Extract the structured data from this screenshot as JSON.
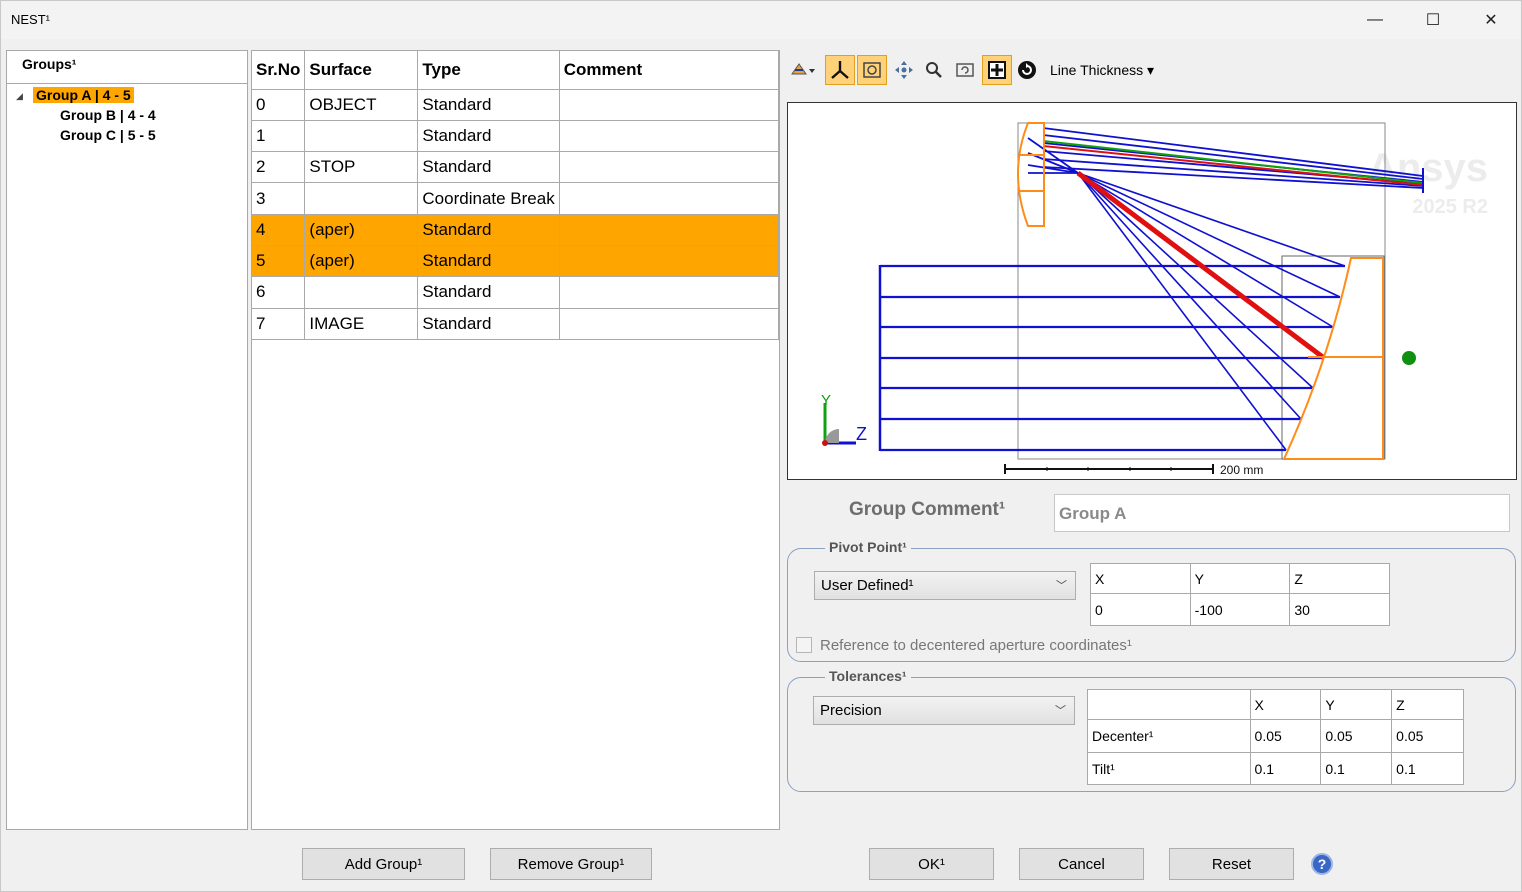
{
  "window": {
    "title": "NEST¹",
    "minimize": "—",
    "maximize": "☐",
    "close": "✕"
  },
  "groups": {
    "header": "Groups¹",
    "items": [
      {
        "label": "Group A | 4 - 5",
        "selected": true
      },
      {
        "label": "Group B | 4 - 4",
        "selected": false
      },
      {
        "label": "Group C | 5 - 5",
        "selected": false
      }
    ]
  },
  "surfaces": {
    "columns": [
      "Sr.No",
      "Surface",
      "Type",
      "Comment"
    ],
    "rows": [
      {
        "no": "0",
        "surface": "OBJECT",
        "type": "Standard",
        "comment": "",
        "highlighted": false
      },
      {
        "no": "1",
        "surface": "",
        "type": "Standard",
        "comment": "",
        "highlighted": false
      },
      {
        "no": "2",
        "surface": "STOP",
        "type": "Standard",
        "comment": "",
        "highlighted": false
      },
      {
        "no": "3",
        "surface": "",
        "type": "Coordinate Break",
        "comment": "",
        "highlighted": false
      },
      {
        "no": "4",
        "surface": "(aper)",
        "type": "Standard",
        "comment": "",
        "highlighted": true
      },
      {
        "no": "5",
        "surface": "(aper)",
        "type": "Standard",
        "comment": "",
        "highlighted": true
      },
      {
        "no": "6",
        "surface": "",
        "type": "Standard",
        "comment": "",
        "highlighted": false
      },
      {
        "no": "7",
        "surface": "IMAGE",
        "type": "Standard",
        "comment": "",
        "highlighted": false
      }
    ]
  },
  "toolbar": {
    "line_thickness": "Line Thickness ▾"
  },
  "viewer": {
    "watermark_line1": "Ansys",
    "watermark_line2": "2025 R2",
    "scale_label": "200 mm",
    "axis_y": "Y",
    "axis_z": "Z"
  },
  "group_comment": {
    "label": "Group Comment¹",
    "value": "Group A"
  },
  "pivot": {
    "legend": "Pivot Point¹",
    "mode": "User Defined¹",
    "headers": [
      "X",
      "Y",
      "Z"
    ],
    "values": [
      "0",
      "-100",
      "30"
    ],
    "checkbox_label": "Reference to decentered aperture coordinates¹",
    "checkbox_checked": false
  },
  "tolerances": {
    "legend": "Tolerances¹",
    "mode": "Precision",
    "headers": [
      "",
      "X",
      "Y",
      "Z"
    ],
    "rows": [
      {
        "label": "Decenter¹",
        "x": "0.05",
        "y": "0.05",
        "z": "0.05"
      },
      {
        "label": "Tilt¹",
        "x": "0.1",
        "y": "0.1",
        "z": "0.1"
      }
    ]
  },
  "buttons": {
    "add_group": "Add Group¹",
    "remove_group": "Remove Group¹",
    "ok": "OK¹",
    "cancel": "Cancel",
    "reset": "Reset",
    "help": "?"
  },
  "colors": {
    "highlight": "#ffa500",
    "ray_blue": "#1010d0",
    "ray_red": "#e01010",
    "ray_green": "#10a010",
    "lens_orange": "#ff8c1a"
  }
}
